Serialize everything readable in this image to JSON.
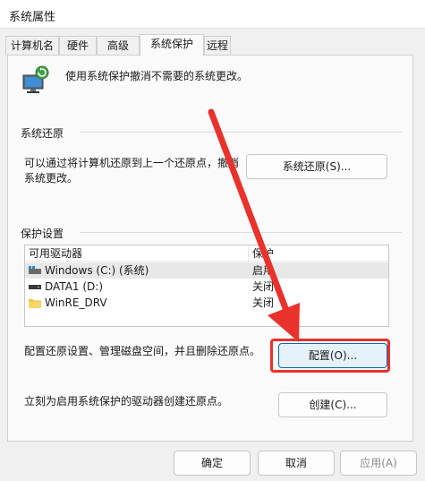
{
  "window": {
    "title": "系统属性"
  },
  "tabs": [
    {
      "label": "计算机名"
    },
    {
      "label": "硬件"
    },
    {
      "label": "高级"
    },
    {
      "label": "系统保护"
    },
    {
      "label": "远程"
    }
  ],
  "intro": {
    "text": "使用系统保护撤消不需要的系统更改。"
  },
  "restore": {
    "title": "系统还原",
    "desc_line1": "可以通过将计算机还原到上一个还原点，撤消",
    "desc_line2": "系统更改。",
    "button": "系统还原(S)..."
  },
  "protection": {
    "title": "保护设置",
    "header_drive": "可用驱动器",
    "header_protect": "保护",
    "drives": [
      {
        "name": "Windows (C:) (系统)",
        "status": "启用"
      },
      {
        "name": "DATA1 (D:)",
        "status": "关闭"
      },
      {
        "name": "WinRE_DRV",
        "status": "关闭"
      }
    ],
    "configure_desc": "配置还原设置、管理磁盘空间，并且删除还原点。",
    "configure_button": "配置(O)...",
    "create_desc": "立刻为启用系统保护的驱动器创建还原点。",
    "create_button": "创建(C)..."
  },
  "footer": {
    "ok": "确定",
    "cancel": "取消",
    "apply": "应用(A)"
  },
  "colors": {
    "annotation": "#e8322b",
    "accent": "#0067c0"
  }
}
